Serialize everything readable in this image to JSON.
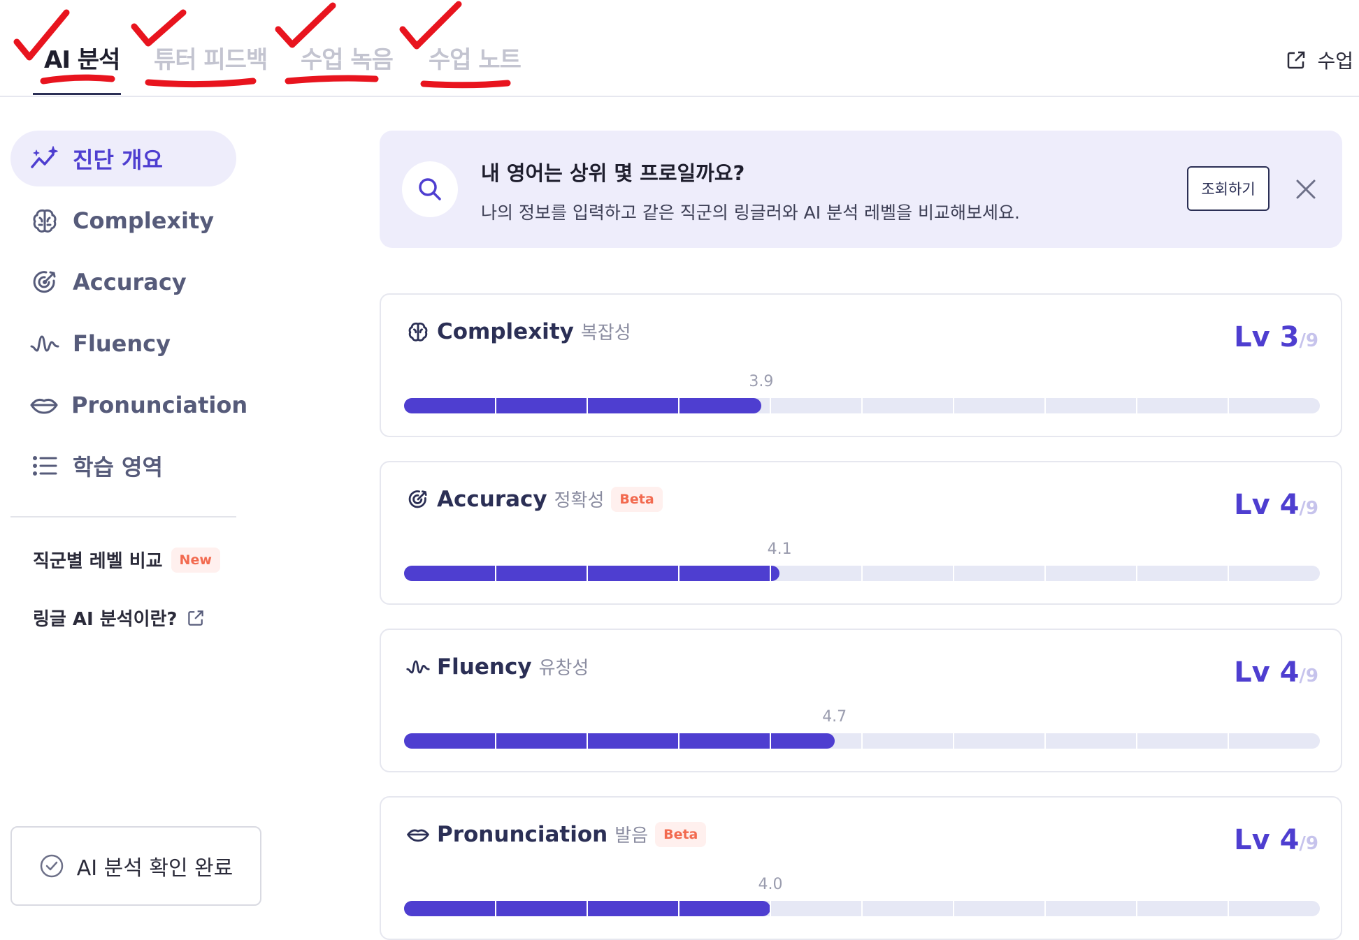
{
  "tabs": [
    {
      "label": "AI 분석",
      "active": true
    },
    {
      "label": "튜터 피드백",
      "active": false
    },
    {
      "label": "수업 녹음",
      "active": false
    },
    {
      "label": "수업 노트",
      "active": false
    }
  ],
  "top_action": {
    "label": "수업"
  },
  "sidebar": {
    "items": [
      {
        "label": "진단 개요",
        "icon": "trend-sparkle-icon",
        "active": true
      },
      {
        "label": "Complexity",
        "icon": "brain-icon"
      },
      {
        "label": "Accuracy",
        "icon": "target-icon"
      },
      {
        "label": "Fluency",
        "icon": "wave-icon"
      },
      {
        "label": "Pronunciation",
        "icon": "lips-icon"
      },
      {
        "label": "학습 영역",
        "icon": "list-icon"
      }
    ],
    "links": [
      {
        "label": "직군별 레벨 비교",
        "badge": "New"
      },
      {
        "label": "링글 AI 분석이란?",
        "icon": "external-link-icon"
      }
    ],
    "confirm_button": "AI 분석 확인 완료"
  },
  "banner": {
    "title": "내 영어는 상위 몇 프로일까요?",
    "subtitle": "나의 정보를 입력하고 같은 직군의 링글러와 AI 분석 레벨을 비교해보세요.",
    "button": "조회하기"
  },
  "metrics": [
    {
      "name": "Complexity",
      "korean": "복잡성",
      "badge": "",
      "level": "Lv 3",
      "max": "/9",
      "score": "3.9",
      "value": 3.9,
      "icon": "brain-icon"
    },
    {
      "name": "Accuracy",
      "korean": "정확성",
      "badge": "Beta",
      "level": "Lv 4",
      "max": "/9",
      "score": "4.1",
      "value": 4.1,
      "icon": "target-icon"
    },
    {
      "name": "Fluency",
      "korean": "유창성",
      "badge": "",
      "level": "Lv 4",
      "max": "/9",
      "score": "4.7",
      "value": 4.7,
      "icon": "wave-icon"
    },
    {
      "name": "Pronunciation",
      "korean": "발음",
      "badge": "Beta",
      "level": "Lv 4",
      "max": "/9",
      "score": "4.0",
      "value": 4.0,
      "icon": "lips-icon"
    }
  ],
  "scale": {
    "min": 0,
    "max": 10,
    "segments": 10
  },
  "colors": {
    "accent": "#4e3ed0",
    "annotation": "#e8141e",
    "track": "#e6e8f5",
    "badge_text": "#f26a4f"
  }
}
